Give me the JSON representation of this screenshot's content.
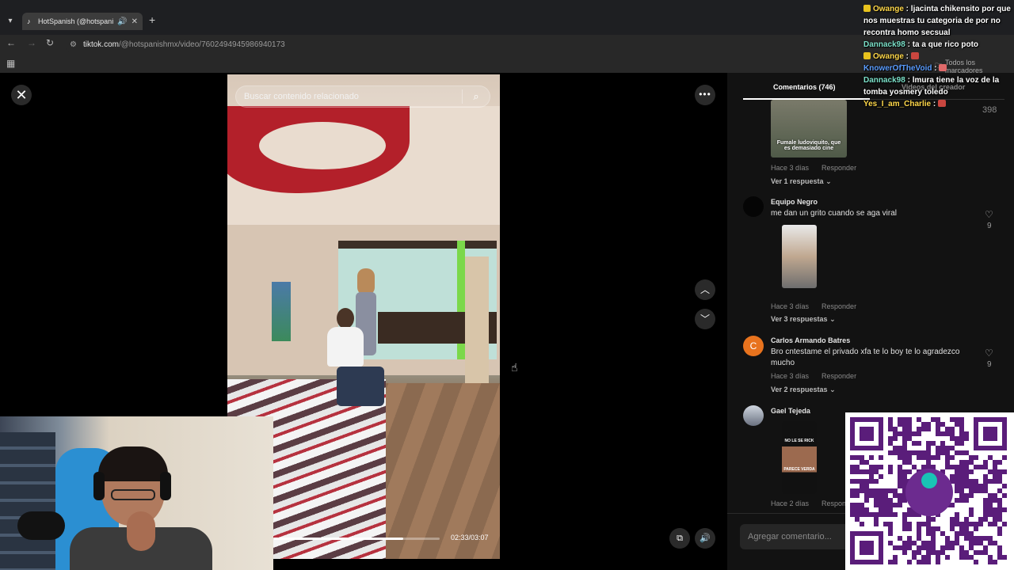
{
  "browser": {
    "tab_title": "HotSpanish (@hotspanishm",
    "url_host": "tiktok.com",
    "url_path": "/@hotspanishmx/video/7602494945986940173",
    "bookmarks_label": "Todos los marcadores"
  },
  "video": {
    "search_placeholder": "Buscar contenido relacionado",
    "timecode": "02:33/03:07",
    "progress_fraction": 0.78
  },
  "comments_panel": {
    "tab_comments": "Comentarios (746)",
    "tab_creator": "Videos del creador",
    "top_like_count": "398",
    "comments": [
      {
        "user": "",
        "meme_caption": "Fumale ludoviquito, que es demasiado cine",
        "age": "Hace 3 días",
        "reply_label": "Responder",
        "replies": "Ver 1 respuesta"
      },
      {
        "user": "Equipo Negro",
        "text": "me dan un grito cuando se aga viral",
        "likes": "9",
        "age": "Hace 3 días",
        "reply_label": "Responder",
        "replies": "Ver 3 respuestas"
      },
      {
        "user": "Carlos Armando Batres",
        "avatar_letter": "C",
        "text": "Bro cntestame el privado xfa te lo boy te lo agradezco mucho",
        "likes": "9",
        "age": "Hace 3 días",
        "reply_label": "Responder",
        "replies": "Ver 2 respuestas"
      },
      {
        "user": "Gael Tejeda",
        "meme_caption_top": "NO LE SE RICK",
        "meme_caption_bottom": "PARECE VERDA",
        "age": "Hace 2 días",
        "reply_label": "Respond"
      }
    ],
    "composer_placeholder": "Agregar comentario..."
  },
  "chat": [
    {
      "user": "Owange",
      "user_color": "#ffd84a",
      "badge": true,
      "message": "ljacinta chikensito por que nos muestras tu categoria de por no recontra homo secsual"
    },
    {
      "user": "Dannack98",
      "user_color": "#7be0c8",
      "badge": false,
      "message": "ta a que rico poto"
    },
    {
      "user": "Owange",
      "user_color": "#ffd84a",
      "badge": true,
      "message": "",
      "emote_color": "#c9463f"
    },
    {
      "user": "KnowerOfTheVoid",
      "user_color": "#5b9dff",
      "badge": false,
      "message": "",
      "emote_color": "#e06a6a"
    },
    {
      "user": "Dannack98",
      "user_color": "#7be0c8",
      "badge": false,
      "message": "lmura tiene la voz de la tomba yosmery toledo"
    },
    {
      "user": "Yes_I_am_Charlie",
      "user_color": "#ffd84a",
      "badge": false,
      "message": "",
      "emote_color": "#c9463f"
    }
  ],
  "colors": {
    "page_bg": "#000000",
    "panel_bg": "#121212",
    "accent_orange": "#e8731e"
  },
  "icons": {
    "close": "close-icon",
    "search": "search-icon",
    "more": "more-icon",
    "arrow_up": "chevron-up-icon",
    "arrow_down": "chevron-down-icon",
    "pip": "picture-in-picture-icon",
    "volume": "volume-icon",
    "heart": "heart-icon"
  }
}
